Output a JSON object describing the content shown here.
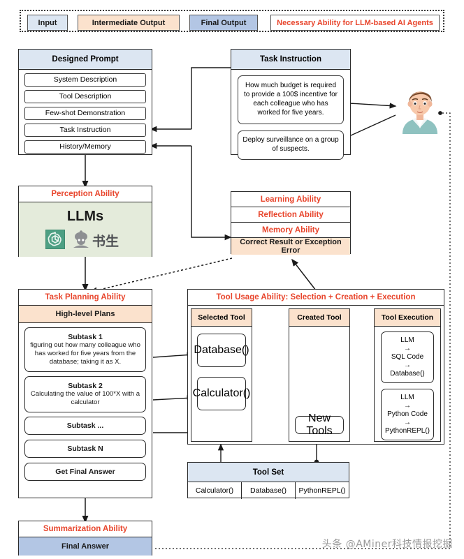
{
  "legend": {
    "items": [
      {
        "label": "Input",
        "color": "#dce6f2"
      },
      {
        "label": "Intermediate Output",
        "color": "#fbe2cd"
      },
      {
        "label": "Final Output",
        "color": "#b3c6e4"
      },
      {
        "label": "Necessary Ability for LLM-based AI Agents",
        "color": "#e8452c"
      }
    ]
  },
  "designed_prompt": {
    "title": "Designed Prompt",
    "items": [
      "System Description",
      "Tool Description",
      "Few-shot Demonstration",
      "Task Instruction",
      "History/Memory"
    ]
  },
  "task_instruction": {
    "title": "Task Instruction",
    "items": [
      "How much budget is required to provide a 100$ incentive for each colleague who has worked for five years.",
      "Deploy surveillance on a group of suspects."
    ]
  },
  "perception": {
    "title": "Perception Ability",
    "llm_label": "LLMs",
    "logos": [
      "openai-logo",
      "shusheng-logo"
    ]
  },
  "abilities": {
    "items": [
      "Learning Ability",
      "Reflection Ability",
      "Memory Ability"
    ],
    "result_box": "Correct Result or Exception Error"
  },
  "task_planning": {
    "title": "Task Planning Ability",
    "subtitle": "High-level Plans",
    "subtasks": [
      {
        "heading": "Subtask 1",
        "body": "figuring out how many colleague who has worked for five years from the database; taking it as X."
      },
      {
        "heading": "Subtask 2",
        "body": "Calculating the value of 100*X with a calculator"
      },
      {
        "heading": "Subtask ...",
        "body": ""
      },
      {
        "heading": "Subtask N",
        "body": ""
      },
      {
        "heading": "Get Final Answer",
        "body": ""
      }
    ]
  },
  "tool_usage": {
    "title": "Tool Usage Ability: Selection + Creation + Execution",
    "columns": [
      {
        "header": "Selected Tool",
        "items": [
          "Database()",
          "Calculator()"
        ]
      },
      {
        "header": "Created Tool",
        "items": [
          "New Tools"
        ]
      },
      {
        "header": "Tool Execution",
        "items": [
          "LLM\n→\nSQL Code\n→\nDatabase()",
          "LLM\n→\nPython Code\n→\nPythonREPL()"
        ]
      }
    ]
  },
  "tool_set": {
    "title": "Tool Set",
    "tools": [
      "Calculator()",
      "Database()",
      "PythonREPL()"
    ]
  },
  "summarization": {
    "title": "Summarization Ability",
    "final_answer": "Final Answer"
  },
  "watermark": {
    "text": "头条 @AMiner科技情报挖掘"
  }
}
